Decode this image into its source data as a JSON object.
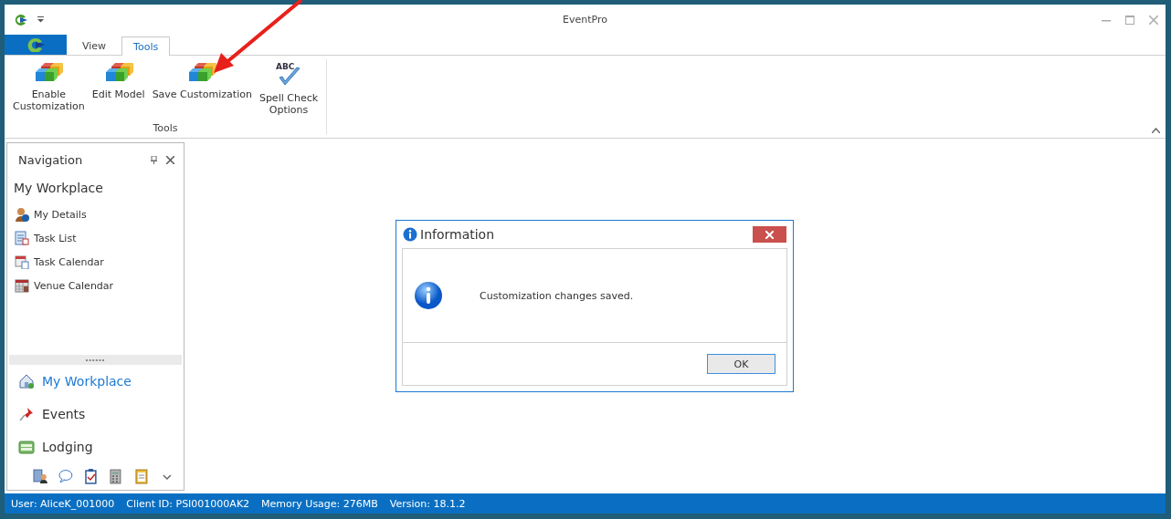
{
  "window": {
    "title": "EventPro"
  },
  "tabs": [
    {
      "label": "View",
      "selected": false
    },
    {
      "label": "Tools",
      "selected": true
    }
  ],
  "ribbon": {
    "buttons": [
      {
        "label": "Enable\nCustomization",
        "kind": "blocks"
      },
      {
        "label": "Edit Model",
        "kind": "blocks"
      },
      {
        "label": "Save Customization",
        "kind": "blocks"
      },
      {
        "label": "Spell Check\nOptions",
        "kind": "spell",
        "icon_text": "ABC"
      }
    ],
    "group_label": "Tools"
  },
  "navigation": {
    "title": "Navigation",
    "section": "My Workplace",
    "items": [
      {
        "label": "My Details",
        "kind": "person"
      },
      {
        "label": "Task List",
        "kind": "list"
      },
      {
        "label": "Task Calendar",
        "kind": "taskcal"
      },
      {
        "label": "Venue Calendar",
        "kind": "calendar"
      }
    ],
    "modules": [
      {
        "label": "My Workplace",
        "kind": "house",
        "selected": true
      },
      {
        "label": "Events",
        "kind": "pin",
        "selected": false
      },
      {
        "label": "Lodging",
        "kind": "lodging",
        "selected": false
      }
    ],
    "toolbar": [
      {
        "kind": "contacts"
      },
      {
        "kind": "chat"
      },
      {
        "kind": "clipboard"
      },
      {
        "kind": "calculator"
      },
      {
        "kind": "notes"
      },
      {
        "kind": "chevron"
      }
    ]
  },
  "dialog": {
    "title": "Information",
    "message": "Customization changes saved.",
    "buttons": [
      "OK"
    ]
  },
  "status_bar": [
    "User: AliceK_001000",
    "Client ID: PSI001000AK2",
    "Memory Usage: 276MB",
    "Version: 18.1.2"
  ]
}
